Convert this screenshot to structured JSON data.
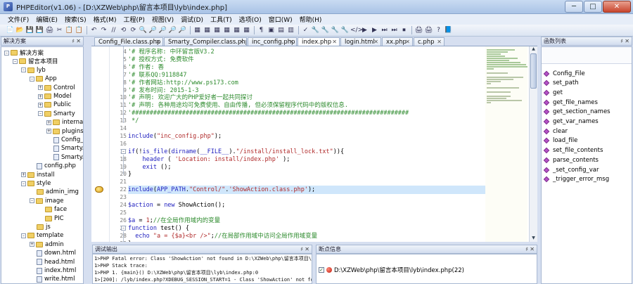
{
  "window": {
    "title": "PHPEditor(v1.06) - [D:\\XZWeb\\php\\留言本项目\\lyb\\index.php]",
    "app_glyph": "P",
    "minimize": "─",
    "maximize": "□",
    "close": "✕"
  },
  "menu": [
    "文件(F)",
    "编辑(E)",
    "搜索(S)",
    "格式(M)",
    "工程(P)",
    "视图(V)",
    "调试(D)",
    "工具(T)",
    "选项(O)",
    "窗口(W)",
    "帮助(H)"
  ],
  "toolbar": {
    "groups": [
      [
        "📄",
        "📂",
        "💾",
        "💾",
        "🖨",
        "✂",
        "📋",
        "📋"
      ],
      [
        "↶",
        "↷",
        "//",
        "⟲",
        "⟳",
        "🔍",
        "🔎",
        "🔎",
        "🔎",
        "🔎"
      ],
      [
        "▦",
        "▦",
        "▦",
        "▦",
        "▦",
        "▦"
      ],
      [
        "¶",
        "▣",
        "▤",
        "▥"
      ],
      [
        "✓",
        "🔧",
        "🔧",
        "🔧",
        "🔧",
        "</>",
        "▶",
        "▶",
        "⏭",
        "⏭",
        "⏹"
      ],
      [
        "🖨",
        "🖨",
        "?",
        "📘"
      ]
    ]
  },
  "left_panel": {
    "title": "解决方案",
    "pin": "♯",
    "close": "✕",
    "tree": [
      {
        "label": "解决方案",
        "depth": 0,
        "kind": "root",
        "expander": "–"
      },
      {
        "label": "留言本项目",
        "depth": 1,
        "kind": "project",
        "expander": "–"
      },
      {
        "label": "lyb",
        "depth": 2,
        "kind": "folder",
        "expander": "–"
      },
      {
        "label": "App",
        "depth": 3,
        "kind": "folder",
        "expander": "–"
      },
      {
        "label": "Control",
        "depth": 4,
        "kind": "folder",
        "expander": "+"
      },
      {
        "label": "Model",
        "depth": 4,
        "kind": "folder",
        "expander": "+"
      },
      {
        "label": "Public",
        "depth": 4,
        "kind": "folder",
        "expander": "+"
      },
      {
        "label": "Smarty",
        "depth": 4,
        "kind": "folder",
        "expander": "–"
      },
      {
        "label": "internal",
        "depth": 5,
        "kind": "folder",
        "expander": "+"
      },
      {
        "label": "plugins",
        "depth": 5,
        "kind": "folder",
        "expander": "+"
      },
      {
        "label": "Config_",
        "depth": 5,
        "kind": "file",
        "expander": ""
      },
      {
        "label": "Smarty.",
        "depth": 5,
        "kind": "file",
        "expander": ""
      },
      {
        "label": "Smarty.",
        "depth": 5,
        "kind": "file",
        "expander": ""
      },
      {
        "label": "config.php",
        "depth": 3,
        "kind": "file",
        "expander": ""
      },
      {
        "label": "install",
        "depth": 2,
        "kind": "folder",
        "expander": "+"
      },
      {
        "label": "style",
        "depth": 2,
        "kind": "folder",
        "expander": "–"
      },
      {
        "label": "admin_img",
        "depth": 3,
        "kind": "folder",
        "expander": ""
      },
      {
        "label": "image",
        "depth": 3,
        "kind": "folder",
        "expander": "–"
      },
      {
        "label": "face",
        "depth": 4,
        "kind": "folder",
        "expander": ""
      },
      {
        "label": "PIC",
        "depth": 4,
        "kind": "folder",
        "expander": ""
      },
      {
        "label": "js",
        "depth": 3,
        "kind": "folder",
        "expander": ""
      },
      {
        "label": "template",
        "depth": 2,
        "kind": "folder",
        "expander": "–"
      },
      {
        "label": "admin",
        "depth": 3,
        "kind": "folder",
        "expander": "+"
      },
      {
        "label": "down.html",
        "depth": 3,
        "kind": "file",
        "expander": ""
      },
      {
        "label": "head.html",
        "depth": 3,
        "kind": "file",
        "expander": ""
      },
      {
        "label": "index.html",
        "depth": 3,
        "kind": "file",
        "expander": ""
      },
      {
        "label": "write.html",
        "depth": 3,
        "kind": "file",
        "expander": ""
      }
    ]
  },
  "tabs": [
    {
      "label": "Config_File.class.php",
      "active": false
    },
    {
      "label": "Smarty_Compiler.class.php",
      "active": false
    },
    {
      "label": "inc_config.php",
      "active": false
    },
    {
      "label": "index.php",
      "active": true
    },
    {
      "label": "login.html",
      "active": false
    },
    {
      "label": "xx.php",
      "active": false
    },
    {
      "label": "c.php",
      "active": false
    }
  ],
  "tab_close": "✕",
  "editor": {
    "lines": [
      {
        "n": "4",
        "tokens": [
          [
            "cmt",
            "'# 程序名称: 中环留言版V3.2"
          ]
        ]
      },
      {
        "n": "5",
        "tokens": [
          [
            "cmt",
            "'# 授权方式: 免费软件"
          ]
        ]
      },
      {
        "n": "6",
        "tokens": [
          [
            "cmt",
            "'# 作者: 香"
          ]
        ]
      },
      {
        "n": "7",
        "tokens": [
          [
            "cmt",
            "'# 联系QQ:9118847"
          ]
        ]
      },
      {
        "n": "8",
        "tokens": [
          [
            "cmt",
            "'# 作者网站:http://www.ps173.com"
          ]
        ]
      },
      {
        "n": "9",
        "tokens": [
          [
            "cmt",
            "'# 发布时间: 2015-1-3"
          ]
        ]
      },
      {
        "n": "10",
        "tokens": [
          [
            "cmt",
            "'# 声明: 欢迎广大的PHP爱好者一起共同探讨"
          ]
        ]
      },
      {
        "n": "11",
        "tokens": [
          [
            "cmt",
            "'# 声明: 各种用途均可免费使用、自由传播, 但必须保留程序代码中的版权信息."
          ]
        ]
      },
      {
        "n": "12",
        "tokens": [
          [
            "cmt",
            "'#############################################################################"
          ]
        ]
      },
      {
        "n": "13",
        "tokens": [
          [
            "cmt",
            " */"
          ]
        ]
      },
      {
        "n": "14",
        "tokens": [
          [
            "def",
            ""
          ]
        ]
      },
      {
        "n": "15",
        "tokens": [
          [
            "kw",
            "include"
          ],
          [
            "def",
            "("
          ],
          [
            "str",
            "\"inc_config.php\""
          ],
          [
            "def",
            ");"
          ]
        ]
      },
      {
        "n": "16",
        "tokens": [
          [
            "def",
            ""
          ]
        ]
      },
      {
        "n": "17",
        "tokens": [
          [
            "kw",
            "if"
          ],
          [
            "def",
            "(!"
          ],
          [
            "fx",
            "is_file"
          ],
          [
            "def",
            "("
          ],
          [
            "fx",
            "dirname"
          ],
          [
            "def",
            "("
          ],
          [
            "kw",
            "__FILE__"
          ],
          [
            "def",
            ")."
          ],
          [
            "str",
            "\"/install/install_lock.txt\""
          ],
          [
            "def",
            ")){"
          ]
        ]
      },
      {
        "n": "18",
        "tokens": [
          [
            "def",
            "    "
          ],
          [
            "fx",
            "header"
          ],
          [
            "def",
            " ( "
          ],
          [
            "str",
            "'Location: install/index.php'"
          ],
          [
            "def",
            " );"
          ]
        ]
      },
      {
        "n": "19",
        "tokens": [
          [
            "def",
            "    "
          ],
          [
            "kw",
            "exit"
          ],
          [
            "def",
            " ();"
          ]
        ]
      },
      {
        "n": "20",
        "tokens": [
          [
            "def",
            "}"
          ]
        ]
      },
      {
        "n": "21",
        "tokens": [
          [
            "def",
            ""
          ]
        ]
      },
      {
        "n": "22",
        "tokens": [
          [
            "kw",
            "include"
          ],
          [
            "def",
            "("
          ],
          [
            "kw",
            "APP_PATH"
          ],
          [
            "def",
            "."
          ],
          [
            "str",
            "\"Control/\""
          ],
          [
            "def",
            "."
          ],
          [
            "str",
            "'ShowAction.class.php'"
          ],
          [
            "def",
            ");"
          ]
        ]
      },
      {
        "n": "23",
        "tokens": [
          [
            "def",
            ""
          ]
        ]
      },
      {
        "n": "24",
        "tokens": [
          [
            "var",
            "$action"
          ],
          [
            "def",
            " = "
          ],
          [
            "kw",
            "new"
          ],
          [
            "def",
            " ShowAction();"
          ]
        ]
      },
      {
        "n": "25",
        "tokens": [
          [
            "def",
            ""
          ]
        ]
      },
      {
        "n": "26",
        "tokens": [
          [
            "var",
            "$a"
          ],
          [
            "def",
            " = "
          ],
          [
            "str",
            "1"
          ],
          [
            "def",
            ";"
          ],
          [
            "cmt",
            "//在全局作用域内的变量"
          ]
        ]
      },
      {
        "n": "27",
        "tokens": [
          [
            "kw",
            "function"
          ],
          [
            "def",
            " test() {"
          ]
        ]
      },
      {
        "n": "28",
        "tokens": [
          [
            "def",
            "  "
          ],
          [
            "kw",
            "echo"
          ],
          [
            "def",
            " "
          ],
          [
            "str",
            "\"a = {$a}<br />\""
          ],
          [
            "def",
            ";"
          ],
          [
            "cmt",
            "//在局部作用域中访问全局作用域变量"
          ]
        ]
      },
      {
        "n": "29",
        "tokens": [
          [
            "def",
            "}"
          ]
        ]
      }
    ],
    "highlight_line": "22",
    "breakpoint_line": "22",
    "scroll_up": "▲",
    "scroll_down": "▼"
  },
  "right_panel": {
    "title": "函数列表",
    "pin": "♯",
    "close": "✕",
    "functions": [
      "Config_File",
      "set_path",
      "get",
      "get_file_names",
      "get_section_names",
      "get_var_names",
      "clear",
      "load_file",
      "set_file_contents",
      "parse_contents",
      "_set_config_var",
      "_trigger_error_msg"
    ]
  },
  "output_panel": {
    "title": "调试输出",
    "pin": "♯",
    "close": "✕",
    "lines": [
      "1>PHP Fatal error:  Class 'ShowAction' not found in D:\\XZWeb\\php\\留言本项目\\lyb\\",
      "1>PHP Stack trace:",
      "1>PHP   1. {main}() D:\\XZWeb\\php\\留言本项目\\lyb\\index.php:0",
      "1>[200]: /lyb/index.php?XDEBUG_SESSION_START=1 - Class 'ShowAction' not found in"
    ]
  },
  "breakpoint_panel": {
    "title": "断点信息",
    "pin": "♯",
    "close": "✕",
    "checkmark": "✓",
    "entries": [
      "D:\\XZWeb\\php\\留言本项目\\lyb\\index.php(22)"
    ]
  }
}
